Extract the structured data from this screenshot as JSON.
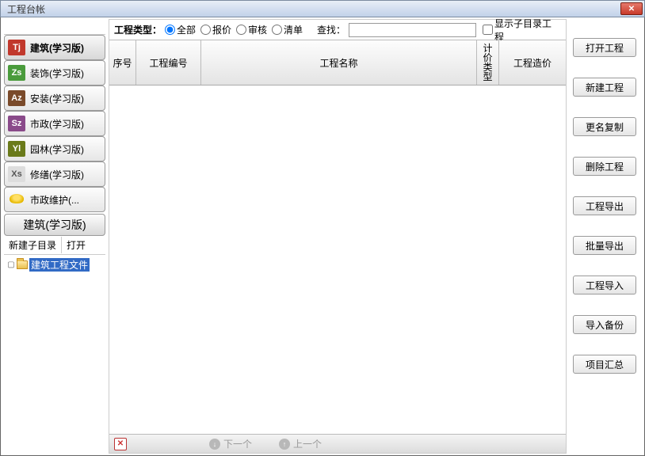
{
  "window": {
    "title": "工程台帐"
  },
  "sidebar": {
    "categories": [
      {
        "icon_text": "Tj",
        "icon_class": "ic-tj",
        "label": "建筑(学习版)"
      },
      {
        "icon_text": "Zs",
        "icon_class": "ic-zs",
        "label": "装饰(学习版)"
      },
      {
        "icon_text": "Az",
        "icon_class": "ic-az",
        "label": "安装(学习版)"
      },
      {
        "icon_text": "Sz",
        "icon_class": "ic-sz",
        "label": "市政(学习版)"
      },
      {
        "icon_text": "Yl",
        "icon_class": "ic-yl",
        "label": "园林(学习版)"
      },
      {
        "icon_text": "Xs",
        "icon_class": "ic-xs",
        "label": "修缮(学习版)"
      },
      {
        "icon_text": "",
        "icon_class": "ic-hat",
        "label": "市政维护(..."
      }
    ],
    "current_section": "建筑(学习版)",
    "subtoolbar": {
      "new_sub": "新建子目录",
      "open": "打开"
    },
    "tree": {
      "root_label": "建筑工程文件"
    }
  },
  "filter": {
    "type_label": "工程类型：",
    "options": {
      "all": "全部",
      "quote": "报价",
      "audit": "审核",
      "list": "清单"
    },
    "selected": "all",
    "search_label": "查找：",
    "search_value": "",
    "show_sub_label": "显示子目录工程",
    "show_sub_checked": false
  },
  "grid": {
    "headers": {
      "seq": "序号",
      "code": "工程编号",
      "name": "工程名称",
      "type": "计价类型",
      "cost": "工程造价"
    },
    "rows": []
  },
  "bottombar": {
    "next": "下一个",
    "prev": "上一个"
  },
  "actions": {
    "open": "打开工程",
    "new": "新建工程",
    "rename_copy": "更名复制",
    "delete": "删除工程",
    "export": "工程导出",
    "batch_export": "批量导出",
    "import": "工程导入",
    "import_backup": "导入备份",
    "summary": "项目汇总"
  }
}
